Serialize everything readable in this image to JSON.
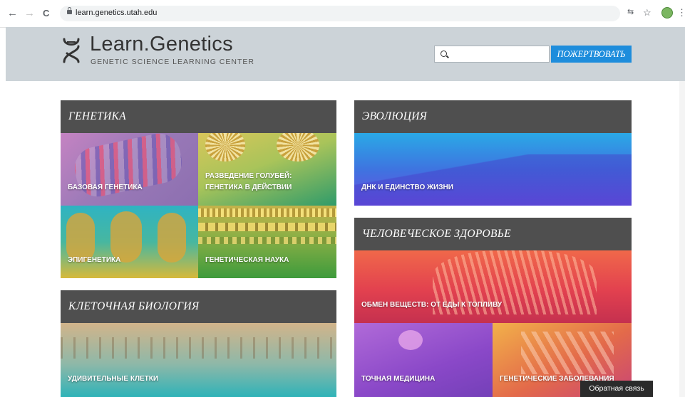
{
  "browser": {
    "url": "learn.genetics.utah.edu",
    "back_glyph": "←",
    "forward_glyph": "→",
    "reload_glyph": "C",
    "translate_glyph": "⇆",
    "star_glyph": "☆",
    "menu_glyph": "⋮"
  },
  "header": {
    "logo_title": "Learn.Genetics",
    "logo_subtitle": "GENETIC SCIENCE LEARNING CENTER",
    "search_placeholder": "",
    "donate_label": "ПОЖЕРТВОВАТЬ"
  },
  "sections": {
    "genetics": {
      "title": "ГЕНЕТИКА",
      "tiles": [
        "БАЗОВАЯ ГЕНЕТИКА",
        "РАЗВЕДЕНИЕ ГОЛУБЕЙ:\nГЕНЕТИКА В ДЕЙСТВИИ",
        "ЭПИГЕНЕТИКА",
        "ГЕНЕТИЧЕСКАЯ НАУКА"
      ]
    },
    "evolution": {
      "title": "ЭВОЛЮЦИЯ",
      "tiles": [
        "ДНК И ЕДИНСТВО ЖИЗНИ"
      ]
    },
    "health": {
      "title": "ЧЕЛОВЕЧЕСКОЕ ЗДОРОВЬЕ",
      "tiles": [
        "ОБМЕН ВЕЩЕСТВ: ОТ ЕДЫ К ТОПЛИВУ",
        "ТОЧНАЯ МЕДИЦИНА",
        "ГЕНЕТИЧЕСКИЕ ЗАБОЛЕВАНИЯ"
      ]
    },
    "cell": {
      "title": "КЛЕТОЧНАЯ БИОЛОГИЯ",
      "tiles": [
        "УДИВИТЕЛЬНЫЕ КЛЕТКИ"
      ]
    }
  },
  "feedback_label": "Обратная связь",
  "colors": {
    "header_bg": "#ccd3d8",
    "section_head": "#4f4f4f",
    "donate_bg": "#1e8ddc"
  }
}
